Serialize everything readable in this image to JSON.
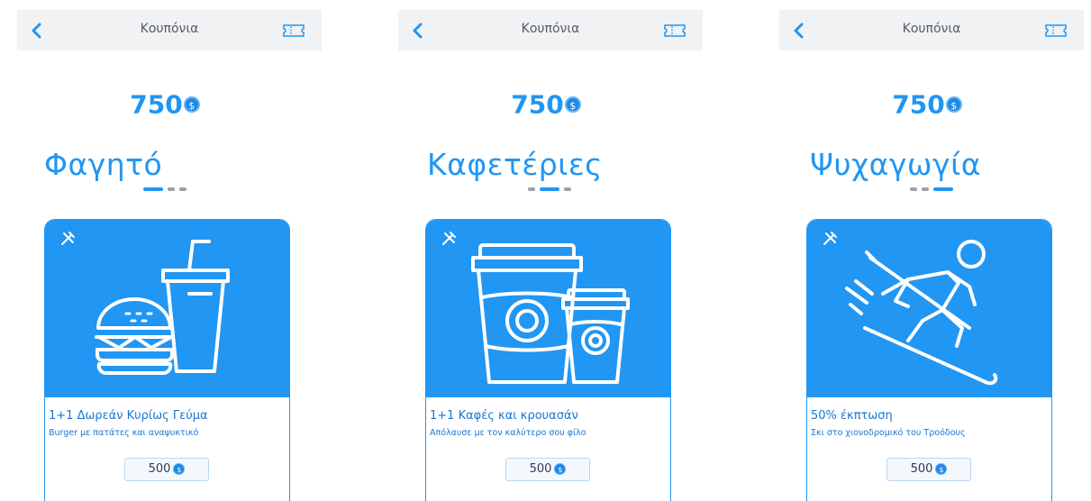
{
  "colors": {
    "accent": "#2196f3",
    "topbar_bg": "#f1f2f4",
    "inactive_dot": "#9aa1ab"
  },
  "screens": [
    {
      "title": "Κουπόνια",
      "balance": "750",
      "category": "Φαγητό",
      "active_dot": 0,
      "offer_title": "1+1 Δωρεάν Κυρίως Γεύμα",
      "offer_sub": "Burger με πατάτες και αναψυκτικό",
      "price": "500",
      "illustration": "burger-drink-icon"
    },
    {
      "title": "Κουπόνια",
      "balance": "750",
      "category": "Καφετέριες",
      "active_dot": 1,
      "offer_title": "1+1 Καφές και κρουασάν",
      "offer_sub": "Απόλαυσε με τον καλύτερο σου φίλο",
      "price": "500",
      "illustration": "coffee-cups-icon"
    },
    {
      "title": "Κουπόνια",
      "balance": "750",
      "category": "Ψυχαγωγία",
      "active_dot": 2,
      "offer_title": "50% έκπτωση",
      "offer_sub": "Σκι στο χιονοδρομικό του Τροόδους",
      "price": "500",
      "illustration": "skier-icon"
    }
  ]
}
